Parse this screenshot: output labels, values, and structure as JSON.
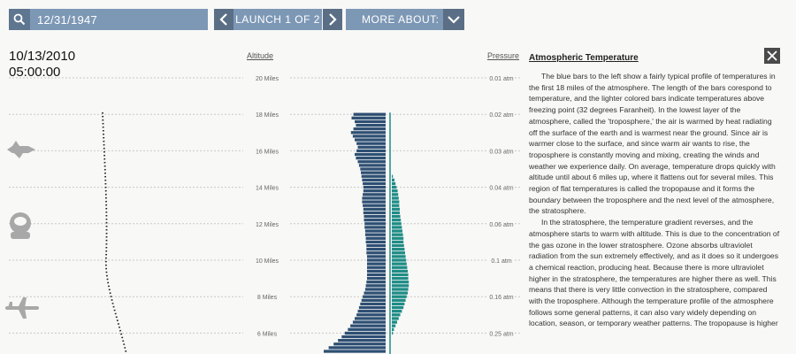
{
  "toolbar": {
    "search_date": "12/31/1947",
    "launch_label": "LAUNCH 1 OF 2",
    "more_about_label": "MORE ABOUT:"
  },
  "datetime": {
    "date": "10/13/2010",
    "time": "05:00:00"
  },
  "chart": {
    "altitude_header": "Altitude",
    "pressure_header": "Pressure",
    "levels": [
      {
        "altitude": 20,
        "altitude_label": "20 Miles",
        "pressure_label": "0.01 atm"
      },
      {
        "altitude": 18,
        "altitude_label": "18 Miles",
        "pressure_label": "0.02 atm"
      },
      {
        "altitude": 16,
        "altitude_label": "16 Miles",
        "pressure_label": "0.03 atm"
      },
      {
        "altitude": 14,
        "altitude_label": "14 Miles",
        "pressure_label": "0.04 atm"
      },
      {
        "altitude": 12,
        "altitude_label": "12 Miles",
        "pressure_label": "0.06 atm"
      },
      {
        "altitude": 10,
        "altitude_label": "10 Miles",
        "pressure_label": "0.1 atm"
      },
      {
        "altitude": 8,
        "altitude_label": "8 Miles",
        "pressure_label": "0.16 atm"
      },
      {
        "altitude": 6,
        "altitude_label": "6 Miles",
        "pressure_label": "0.25 atm"
      }
    ],
    "colors": {
      "below_freezing": "#2e4f73",
      "above_freezing": "#1f8c86",
      "freezing_line": "#1f8c86",
      "gridline": "#c8c8c8",
      "trajectory": "#222222",
      "icons": "#a8a8a8"
    },
    "temperature_bars": [
      {
        "altitude": 18.0,
        "below": 0.52,
        "above": 0.0
      },
      {
        "altitude": 17.8,
        "below": 0.55,
        "above": 0.0
      },
      {
        "altitude": 17.6,
        "below": 0.5,
        "above": 0.0
      },
      {
        "altitude": 17.4,
        "below": 0.48,
        "above": 0.0
      },
      {
        "altitude": 17.2,
        "below": 0.52,
        "above": 0.0
      },
      {
        "altitude": 17.0,
        "below": 0.56,
        "above": 0.0
      },
      {
        "altitude": 16.8,
        "below": 0.53,
        "above": 0.0
      },
      {
        "altitude": 16.6,
        "below": 0.5,
        "above": 0.0
      },
      {
        "altitude": 16.4,
        "below": 0.47,
        "above": 0.0
      },
      {
        "altitude": 16.2,
        "below": 0.45,
        "above": 0.0
      },
      {
        "altitude": 16.0,
        "below": 0.47,
        "above": 0.0
      },
      {
        "altitude": 15.8,
        "below": 0.5,
        "above": 0.0
      },
      {
        "altitude": 15.6,
        "below": 0.48,
        "above": 0.0
      },
      {
        "altitude": 15.4,
        "below": 0.45,
        "above": 0.0
      },
      {
        "altitude": 15.2,
        "below": 0.43,
        "above": 0.0
      },
      {
        "altitude": 15.0,
        "below": 0.41,
        "above": 0.0
      },
      {
        "altitude": 14.8,
        "below": 0.4,
        "above": 0.0
      },
      {
        "altitude": 14.6,
        "below": 0.39,
        "above": 0.02
      },
      {
        "altitude": 14.4,
        "below": 0.38,
        "above": 0.05
      },
      {
        "altitude": 14.2,
        "below": 0.37,
        "above": 0.07
      },
      {
        "altitude": 14.0,
        "below": 0.36,
        "above": 0.09
      },
      {
        "altitude": 13.8,
        "below": 0.36,
        "above": 0.11
      },
      {
        "altitude": 13.6,
        "below": 0.37,
        "above": 0.12
      },
      {
        "altitude": 13.4,
        "below": 0.38,
        "above": 0.13
      },
      {
        "altitude": 13.2,
        "below": 0.38,
        "above": 0.14
      },
      {
        "altitude": 13.0,
        "below": 0.37,
        "above": 0.14
      },
      {
        "altitude": 12.8,
        "below": 0.36,
        "above": 0.15
      },
      {
        "altitude": 12.6,
        "below": 0.36,
        "above": 0.15
      },
      {
        "altitude": 12.4,
        "below": 0.35,
        "above": 0.16
      },
      {
        "altitude": 12.2,
        "below": 0.35,
        "above": 0.17
      },
      {
        "altitude": 12.0,
        "below": 0.34,
        "above": 0.18
      },
      {
        "altitude": 11.8,
        "below": 0.34,
        "above": 0.19
      },
      {
        "altitude": 11.6,
        "below": 0.33,
        "above": 0.2
      },
      {
        "altitude": 11.4,
        "below": 0.33,
        "above": 0.21
      },
      {
        "altitude": 11.2,
        "below": 0.32,
        "above": 0.22
      },
      {
        "altitude": 11.0,
        "below": 0.32,
        "above": 0.22
      },
      {
        "altitude": 10.8,
        "below": 0.31,
        "above": 0.23
      },
      {
        "altitude": 10.6,
        "below": 0.31,
        "above": 0.24
      },
      {
        "altitude": 10.4,
        "below": 0.31,
        "above": 0.25
      },
      {
        "altitude": 10.2,
        "below": 0.3,
        "above": 0.26
      },
      {
        "altitude": 10.0,
        "below": 0.3,
        "above": 0.27
      },
      {
        "altitude": 9.8,
        "below": 0.3,
        "above": 0.28
      },
      {
        "altitude": 9.6,
        "below": 0.3,
        "above": 0.29
      },
      {
        "altitude": 9.4,
        "below": 0.3,
        "above": 0.3
      },
      {
        "altitude": 9.2,
        "below": 0.3,
        "above": 0.31
      },
      {
        "altitude": 9.0,
        "below": 0.3,
        "above": 0.31
      },
      {
        "altitude": 8.8,
        "below": 0.31,
        "above": 0.32
      },
      {
        "altitude": 8.6,
        "below": 0.32,
        "above": 0.32
      },
      {
        "altitude": 8.4,
        "below": 0.33,
        "above": 0.31
      },
      {
        "altitude": 8.2,
        "below": 0.35,
        "above": 0.3
      },
      {
        "altitude": 8.0,
        "below": 0.37,
        "above": 0.28
      },
      {
        "altitude": 7.8,
        "below": 0.39,
        "above": 0.26
      },
      {
        "altitude": 7.6,
        "below": 0.41,
        "above": 0.24
      },
      {
        "altitude": 7.4,
        "below": 0.43,
        "above": 0.22
      },
      {
        "altitude": 7.2,
        "below": 0.45,
        "above": 0.19
      },
      {
        "altitude": 7.0,
        "below": 0.47,
        "above": 0.16
      },
      {
        "altitude": 6.8,
        "below": 0.5,
        "above": 0.13
      },
      {
        "altitude": 6.6,
        "below": 0.53,
        "above": 0.1
      },
      {
        "altitude": 6.4,
        "below": 0.57,
        "above": 0.07
      },
      {
        "altitude": 6.2,
        "below": 0.61,
        "above": 0.04
      },
      {
        "altitude": 6.0,
        "below": 0.66,
        "above": 0.02
      },
      {
        "altitude": 5.8,
        "below": 0.71,
        "above": 0.0
      },
      {
        "altitude": 5.6,
        "below": 0.77,
        "above": 0.0
      },
      {
        "altitude": 5.4,
        "below": 0.84,
        "above": 0.0
      },
      {
        "altitude": 5.2,
        "below": 0.92,
        "above": 0.0
      },
      {
        "altitude": 5.0,
        "below": 1.0,
        "above": 0.0
      }
    ],
    "side_icons": [
      "space-shuttle-icon",
      "astronaut-icon",
      "airplane-icon"
    ]
  },
  "article": {
    "title": "Atmospheric Temperature",
    "paragraphs": [
      "The blue bars to the left show a fairly typical profile of temperatures in the first 18 miles of the atmosphere. The length of the bars corespond to temperature, and the lighter colored bars indicate temperatures above freezing point (32 degrees Faranheit). In the lowest layer of the atmosphere, called the 'troposphere,' the air is warmed by heat radiating off the surface of the earth and is warmest near the ground. Since air is warmer close to the surface, and since warm air wants to rise, the troposphere is constantly moving and mixing, creating the winds and weather we experience daily. On average, temperature drops quickly with altitude until about 6 miles up, where it flattens out for several miles. This region of flat temperatures is called the tropopause and it forms the boundary between the troposphere and the next level of the atmosphere, the stratosphere.",
      "In the stratosphere, the temperature gradient reverses, and the atmosphere starts to warm with altitude. This is due to the concentration of the gas ozone in the lower stratosphere. Ozone absorbs ultraviolet radiation from the sun extremely effectively, and as it does so it undergoes a chemical reaction, producing heat. Because there is more ultraviolet higher in the stratosphere, the temperatures are higher there as well. This means that there is very little convection in the stratosphere, compared with the troposphere. Although the temperature profile of the atmosphere follows some general patterns, it can also vary widely depending on location, season, or temporary weather patterns. The tropopause is higher"
    ]
  }
}
